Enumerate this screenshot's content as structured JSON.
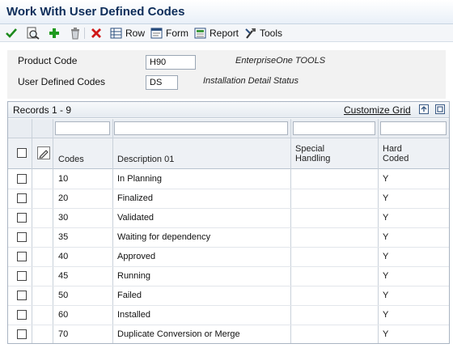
{
  "window": {
    "title": "Work With User Defined Codes"
  },
  "toolbar": {
    "select_icon": "checkmark-icon",
    "find_icon": "find-icon",
    "add_icon": "plus-icon",
    "delete_icon": "trash-icon",
    "close_icon": "red-x-icon",
    "row_label": "Row",
    "form_label": "Form",
    "report_label": "Report",
    "tools_label": "Tools"
  },
  "criteria": {
    "product_code_label": "Product Code",
    "product_code_value": "H90",
    "product_code_desc": "EnterpriseOne TOOLS",
    "udc_label": "User Defined Codes",
    "udc_value": "DS",
    "udc_desc": "Installation Detail Status"
  },
  "grid": {
    "records_label": "Records 1 - 9",
    "customize_label": "Customize Grid",
    "columns": {
      "codes": "Codes",
      "description": "Description 01",
      "special_1": "Special",
      "special_2": "Handling",
      "hard_1": "Hard",
      "hard_2": "Coded"
    },
    "rows": [
      {
        "code": "10",
        "description": "In Planning",
        "special": "",
        "hard_coded": "Y"
      },
      {
        "code": "20",
        "description": "Finalized",
        "special": "",
        "hard_coded": "Y"
      },
      {
        "code": "30",
        "description": "Validated",
        "special": "",
        "hard_coded": "Y"
      },
      {
        "code": "35",
        "description": "Waiting for dependency",
        "special": "",
        "hard_coded": "Y"
      },
      {
        "code": "40",
        "description": "Approved",
        "special": "",
        "hard_coded": "Y"
      },
      {
        "code": "45",
        "description": "Running",
        "special": "",
        "hard_coded": "Y"
      },
      {
        "code": "50",
        "description": "Failed",
        "special": "",
        "hard_coded": "Y"
      },
      {
        "code": "60",
        "description": "Installed",
        "special": "",
        "hard_coded": "Y"
      },
      {
        "code": "70",
        "description": "Duplicate Conversion or Merge",
        "special": "",
        "hard_coded": "Y"
      }
    ]
  }
}
